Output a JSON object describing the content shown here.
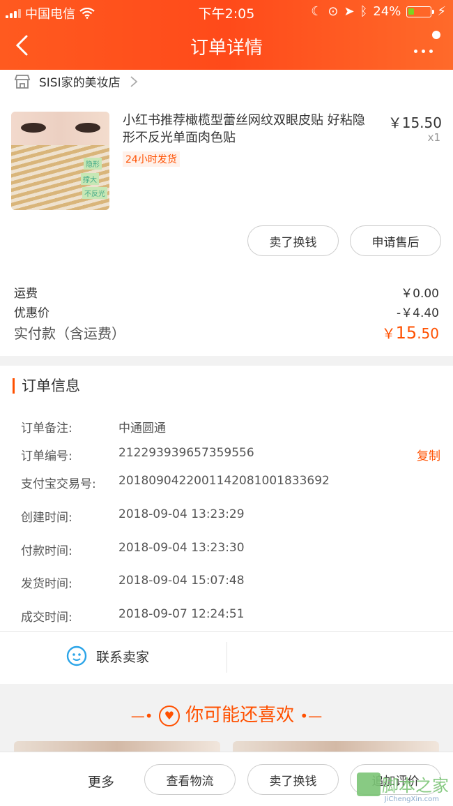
{
  "status_bar": {
    "carrier": "中国电信",
    "time": "下午2:05",
    "battery": "24%"
  },
  "nav": {
    "title": "订单详情"
  },
  "shop": {
    "name": "SISI家的美妆店"
  },
  "product": {
    "name": "小红书推荐橄榄型蕾丝网纹双眼皮贴 好粘隐形不反光单面肉色贴",
    "price": "￥15.50",
    "qty": "x1",
    "badge": "24小时发货",
    "image_tags": [
      "隐形",
      "撑大",
      "不反光"
    ]
  },
  "actions": {
    "sell": "卖了换钱",
    "after_sale": "申请售后"
  },
  "fees": {
    "shipping_label": "运费",
    "shipping_value": "￥0.00",
    "discount_label": "优惠价",
    "discount_value": "-￥4.40",
    "paid_label": "实付款（含运费）",
    "paid_currency": "￥",
    "paid_int": "15",
    "paid_dec": ".50"
  },
  "order_info": {
    "title": "订单信息",
    "rows": [
      {
        "label": "订单备注:",
        "value": "中通圆通"
      },
      {
        "label": "订单编号:",
        "value": "212293939657359556",
        "action": "复制"
      },
      {
        "label": "支付宝交易号:",
        "value": "2018090422001142081001833692"
      },
      {
        "label": "创建时间:",
        "value": "2018-09-04 13:23:29"
      },
      {
        "label": "付款时间:",
        "value": "2018-09-04 13:23:30"
      },
      {
        "label": "发货时间:",
        "value": "2018-09-04 15:07:48"
      },
      {
        "label": "成交时间:",
        "value": "2018-09-07 12:24:51"
      }
    ]
  },
  "contact": {
    "label": "联系卖家"
  },
  "recommend": {
    "title": "你可能还喜欢"
  },
  "bottom_bar": {
    "more": "更多",
    "logistics": "查看物流",
    "sell": "卖了换钱",
    "review": "追加评价"
  },
  "watermark": {
    "text": "脚本之家",
    "url": "JiChengXin.com"
  },
  "colors": {
    "accent": "#ff5000",
    "header": "#ff4a1a"
  }
}
